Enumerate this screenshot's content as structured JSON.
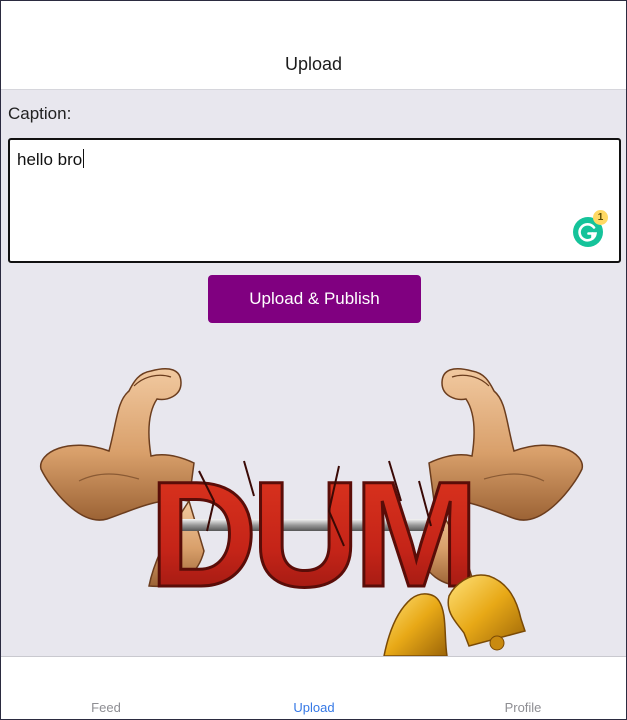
{
  "header": {
    "title": "Upload"
  },
  "form": {
    "caption_label": "Caption:",
    "caption_value": "hello bro",
    "grammarly_count": "1",
    "publish_label": "Upload & Publish"
  },
  "preview": {
    "image_text": "DUM"
  },
  "tabbar": {
    "tabs": [
      {
        "label": "Feed",
        "active": false
      },
      {
        "label": "Upload",
        "active": true
      },
      {
        "label": "Profile",
        "active": false
      }
    ],
    "active_color": "#3578e5",
    "inactive_color": "#8e8e93"
  },
  "colors": {
    "accent": "#800080",
    "background": "#e8e7ee",
    "grammarly": "#15c39a"
  }
}
